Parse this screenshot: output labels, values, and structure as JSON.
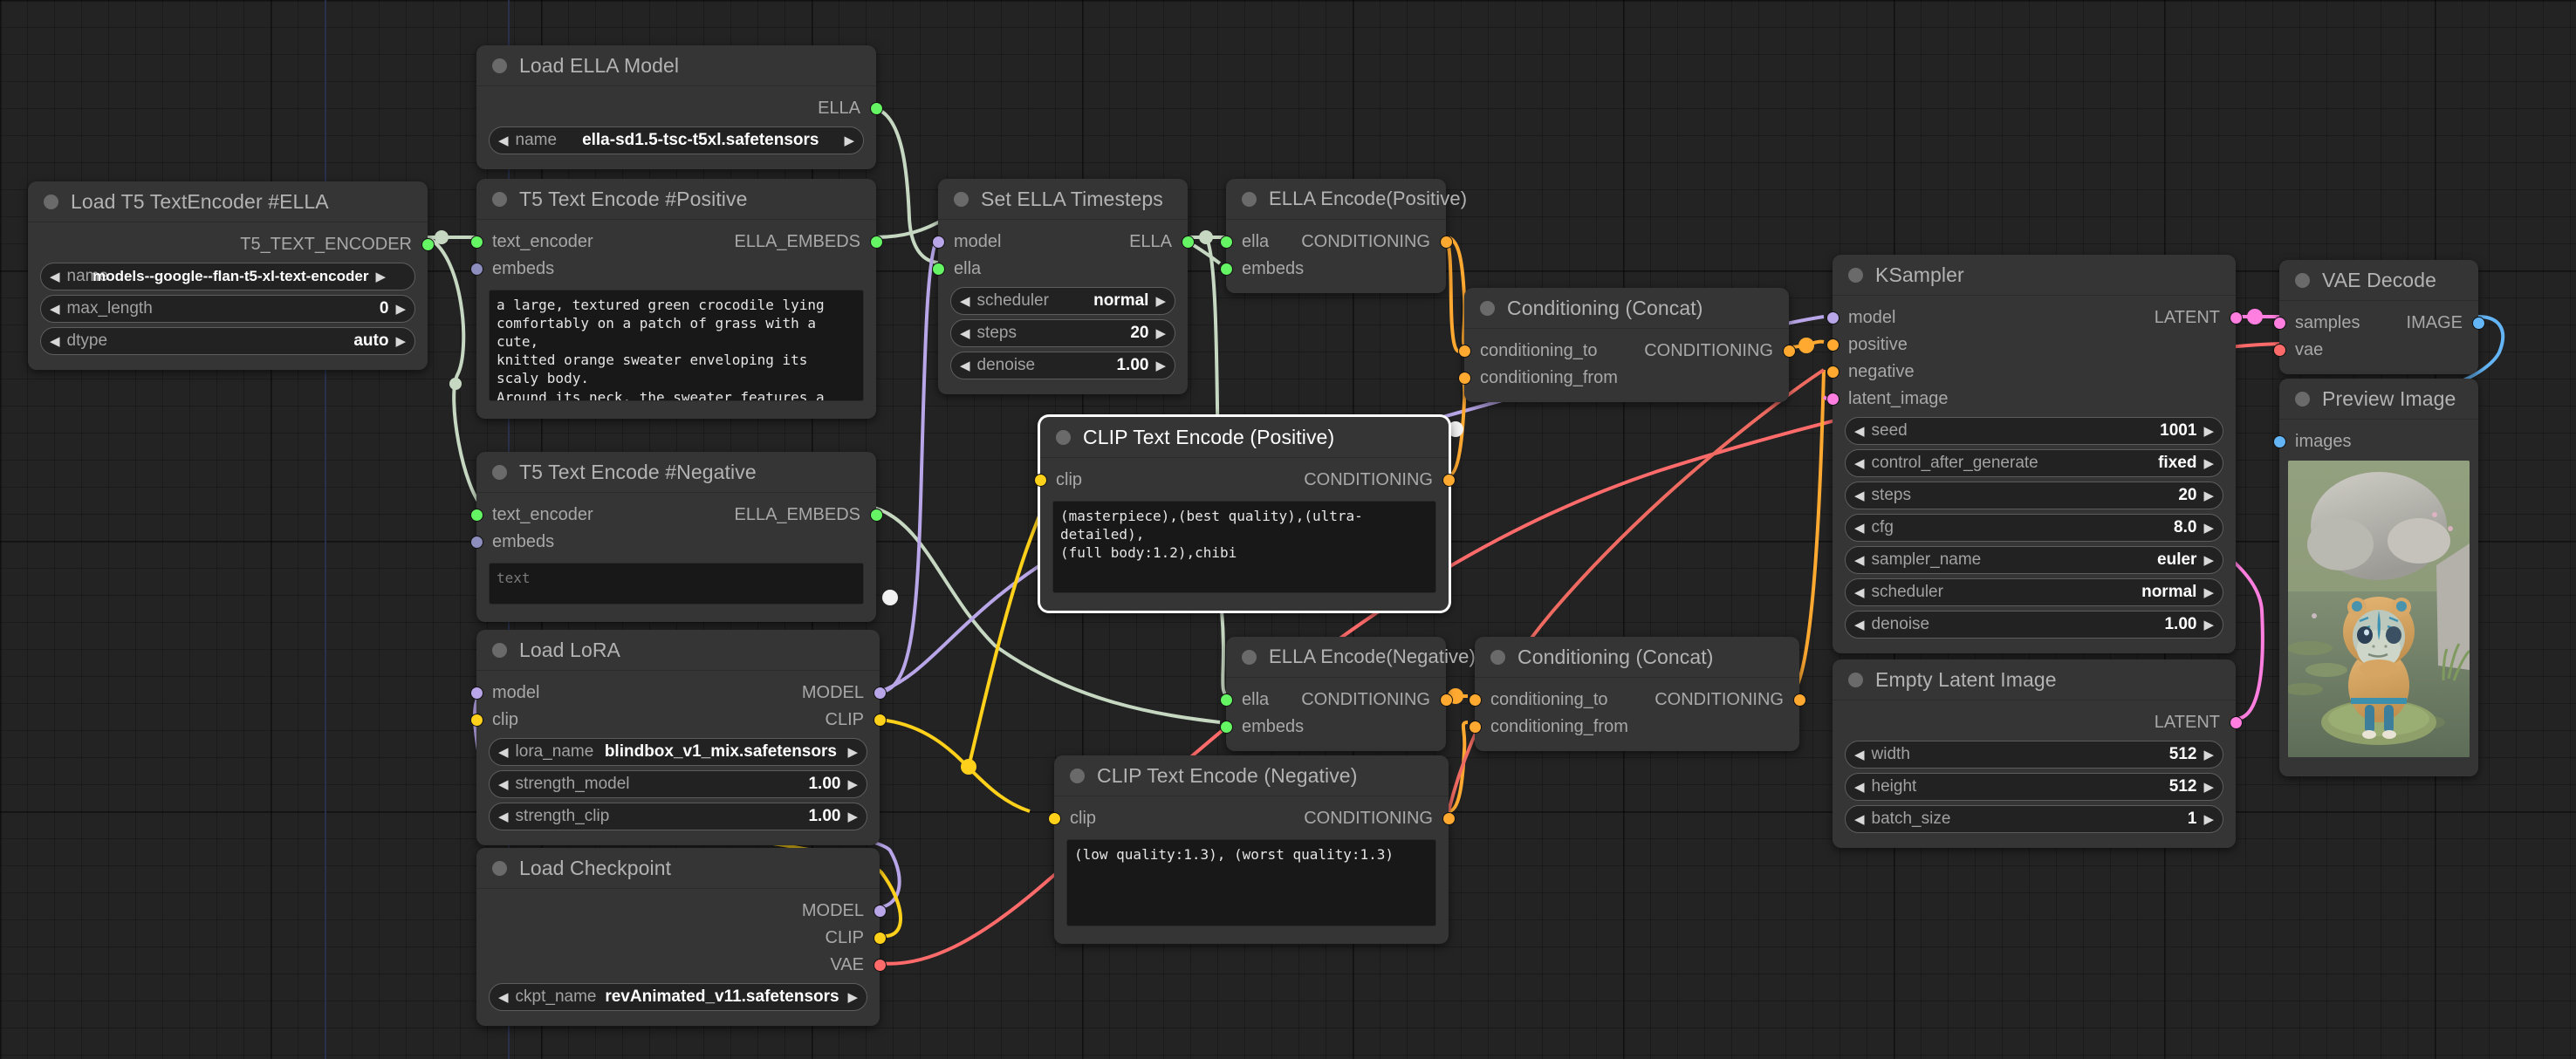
{
  "canvas": {
    "bg": "#232323",
    "grid": "#1c1c1c"
  },
  "nodes": {
    "load_t5": {
      "title": "Load T5 TextEncoder #ELLA",
      "outputs": [
        {
          "label": "T5_TEXT_ENCODER",
          "color": "#65f564"
        }
      ],
      "widgets": [
        {
          "name": "name",
          "value": "models--google--flan-t5-xl-text-encoder"
        },
        {
          "name": "max_length",
          "value": "0"
        },
        {
          "name": "dtype",
          "value": "auto"
        }
      ]
    },
    "load_ella": {
      "title": "Load ELLA Model",
      "outputs": [
        {
          "label": "ELLA",
          "color": "#65f564"
        }
      ],
      "widgets": [
        {
          "name": "name",
          "value": "ella-sd1.5-tsc-t5xl.safetensors"
        }
      ]
    },
    "t5_positive": {
      "title": "T5 Text Encode #Positive",
      "inputs": [
        {
          "label": "text_encoder",
          "color": "#65f564"
        },
        {
          "label": "embeds",
          "color": "#8d8dbe"
        }
      ],
      "outputs": [
        {
          "label": "ELLA_EMBEDS",
          "color": "#65f564"
        }
      ],
      "text": "a large, textured green crocodile lying\ncomfortably on a patch of grass with a cute,\nknitted orange sweater enveloping its scaly body.\nAround its neck, the sweater features a whimsical\npattern of blue and yellow stripes. In the\nbackground, a smooth, grey rock partially\nobscures the view of a small pond with lily pads\nfloating on the surface."
    },
    "t5_negative": {
      "title": "T5 Text Encode #Negative",
      "inputs": [
        {
          "label": "text_encoder",
          "color": "#65f564"
        },
        {
          "label": "embeds",
          "color": "#8d8dbe"
        }
      ],
      "outputs": [
        {
          "label": "ELLA_EMBEDS",
          "color": "#65f564"
        }
      ],
      "text": "text",
      "text_is_placeholder": true
    },
    "set_ella_timesteps": {
      "title": "Set ELLA Timesteps",
      "inputs": [
        {
          "label": "model",
          "color": "#b8a6e8"
        },
        {
          "label": "ella",
          "color": "#65f564"
        }
      ],
      "outputs": [
        {
          "label": "ELLA",
          "color": "#65f564"
        }
      ],
      "widgets": [
        {
          "name": "scheduler",
          "value": "normal"
        },
        {
          "name": "steps",
          "value": "20"
        },
        {
          "name": "denoise",
          "value": "1.00"
        }
      ]
    },
    "ella_encode_positive": {
      "title": "ELLA Encode(Positive)",
      "inputs": [
        {
          "label": "ella",
          "color": "#65f564"
        },
        {
          "label": "embeds",
          "color": "#65f564"
        }
      ],
      "outputs": [
        {
          "label": "CONDITIONING",
          "color": "#ffa931"
        }
      ]
    },
    "ella_encode_negative": {
      "title": "ELLA Encode(Negative)",
      "inputs": [
        {
          "label": "ella",
          "color": "#65f564"
        },
        {
          "label": "embeds",
          "color": "#65f564"
        }
      ],
      "outputs": [
        {
          "label": "CONDITIONING",
          "color": "#ffa931"
        }
      ]
    },
    "concat_positive": {
      "title": "Conditioning (Concat)",
      "inputs": [
        {
          "label": "conditioning_to",
          "color": "#ffa931"
        },
        {
          "label": "conditioning_from",
          "color": "#ffa931"
        }
      ],
      "outputs": [
        {
          "label": "CONDITIONING",
          "color": "#ffa931"
        }
      ]
    },
    "concat_negative": {
      "title": "Conditioning (Concat)",
      "inputs": [
        {
          "label": "conditioning_to",
          "color": "#ffa931"
        },
        {
          "label": "conditioning_from",
          "color": "#ffa931"
        }
      ],
      "outputs": [
        {
          "label": "CONDITIONING",
          "color": "#ffa931"
        }
      ]
    },
    "clip_positive": {
      "title": "CLIP Text Encode (Positive)",
      "selected": true,
      "inputs": [
        {
          "label": "clip",
          "color": "#ffd11a"
        }
      ],
      "outputs": [
        {
          "label": "CONDITIONING",
          "color": "#ffa931"
        }
      ],
      "text": "(masterpiece),(best quality),(ultra-detailed),\n(full body:1.2),chibi"
    },
    "clip_negative": {
      "title": "CLIP Text Encode (Negative)",
      "inputs": [
        {
          "label": "clip",
          "color": "#ffd11a"
        }
      ],
      "outputs": [
        {
          "label": "CONDITIONING",
          "color": "#ffa931"
        }
      ],
      "text": "(low quality:1.3), (worst quality:1.3)"
    },
    "load_lora": {
      "title": "Load LoRA",
      "inputs": [
        {
          "label": "model",
          "color": "#b8a6e8"
        },
        {
          "label": "clip",
          "color": "#ffd11a"
        }
      ],
      "outputs": [
        {
          "label": "MODEL",
          "color": "#b8a6e8"
        },
        {
          "label": "CLIP",
          "color": "#ffd11a"
        }
      ],
      "widgets": [
        {
          "name": "lora_name",
          "value": "blindbox_v1_mix.safetensors"
        },
        {
          "name": "strength_model",
          "value": "1.00"
        },
        {
          "name": "strength_clip",
          "value": "1.00"
        }
      ]
    },
    "load_checkpoint": {
      "title": "Load Checkpoint",
      "outputs": [
        {
          "label": "MODEL",
          "color": "#b8a6e8"
        },
        {
          "label": "CLIP",
          "color": "#ffd11a"
        },
        {
          "label": "VAE",
          "color": "#ff6b6b"
        }
      ],
      "widgets": [
        {
          "name": "ckpt_name",
          "value": "revAnimated_v11.safetensors"
        }
      ]
    },
    "ksampler": {
      "title": "KSampler",
      "inputs": [
        {
          "label": "model",
          "color": "#b8a6e8"
        },
        {
          "label": "positive",
          "color": "#ffa931"
        },
        {
          "label": "negative",
          "color": "#ffa931"
        },
        {
          "label": "latent_image",
          "color": "#ff7fe0"
        }
      ],
      "outputs": [
        {
          "label": "LATENT",
          "color": "#ff7fe0"
        }
      ],
      "widgets": [
        {
          "name": "seed",
          "value": "1001"
        },
        {
          "name": "control_after_generate",
          "value": "fixed"
        },
        {
          "name": "steps",
          "value": "20"
        },
        {
          "name": "cfg",
          "value": "8.0"
        },
        {
          "name": "sampler_name",
          "value": "euler"
        },
        {
          "name": "scheduler",
          "value": "normal"
        },
        {
          "name": "denoise",
          "value": "1.00"
        }
      ]
    },
    "empty_latent": {
      "title": "Empty Latent Image",
      "outputs": [
        {
          "label": "LATENT",
          "color": "#ff7fe0"
        }
      ],
      "widgets": [
        {
          "name": "width",
          "value": "512"
        },
        {
          "name": "height",
          "value": "512"
        },
        {
          "name": "batch_size",
          "value": "1"
        }
      ]
    },
    "vae_decode": {
      "title": "VAE Decode",
      "inputs": [
        {
          "label": "samples",
          "color": "#ff7fe0"
        },
        {
          "label": "vae",
          "color": "#ff6b6b"
        }
      ],
      "outputs": [
        {
          "label": "IMAGE",
          "color": "#64b5f6"
        }
      ]
    },
    "preview_image": {
      "title": "Preview Image",
      "inputs": [
        {
          "label": "images",
          "color": "#64b5f6"
        }
      ],
      "image_alt": "chibi crocodile in orange knitted sweater on grass beside a pond with lily pads and grey rocks"
    }
  },
  "link_colors": {
    "t5_encoder": "#c6d8c2",
    "ella": "#c6d8c2",
    "conditioning": "#ffa931",
    "model": "#b8a6e8",
    "clip": "#ffd11a",
    "vae": "#ff6b6b",
    "latent": "#ff7fe0",
    "image": "#64b5f6"
  }
}
